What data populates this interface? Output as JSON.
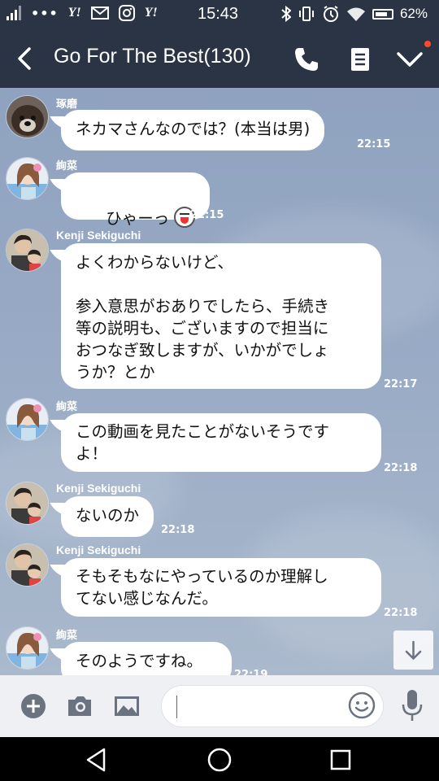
{
  "status_bar": {
    "time": "15:43",
    "carrier_icons": [
      "signal-icon",
      "more-dots-icon",
      "yahoo-icon",
      "mail-icon",
      "instagram-icon",
      "yahoo-icon"
    ],
    "more_dots": "•••",
    "yahoo_1": "Y!",
    "yahoo_2": "Y!",
    "system_icons": [
      "bluetooth-icon",
      "vibrate-icon",
      "alarm-icon",
      "wifi-icon",
      "battery-icon"
    ],
    "battery_percent": "62%",
    "battery_level": 0.62
  },
  "header": {
    "title": "Go For The Best(130)",
    "icons": [
      "back-icon",
      "phone-icon",
      "notes-icon",
      "chevron-check-icon"
    ],
    "notification_color": "#ff4a2b"
  },
  "messages": [
    {
      "sender": "琢磨",
      "text": "ネカマさんなのでは？(本当は男)",
      "time": "22:15",
      "avatar": "dog-avatar"
    },
    {
      "sender": "絢菜",
      "text": "ひゃーっ",
      "time": "22:15",
      "avatar": "girl-avatar",
      "sticker": "surprised-face-icon"
    },
    {
      "sender": "Kenji Sekiguchi",
      "text": "よくわからないけど、\n\n参入意思がおありでしたら、手続き\n等の説明も、ございますので担当に\nおつなぎ致しますが、いかがでしょ\nうか？とか",
      "time": "22:17",
      "avatar": "person-avatar"
    },
    {
      "sender": "絢菜",
      "text": "この動画を見たことがないそうです\nよ！",
      "time": "22:18",
      "avatar": "girl-avatar"
    },
    {
      "sender": "Kenji Sekiguchi",
      "text": "ないのか",
      "time": "22:18",
      "avatar": "person-avatar"
    },
    {
      "sender": "Kenji Sekiguchi",
      "text": "そもそもなにやっているのか理解し\nてない感じなんだ。",
      "time": "22:18",
      "avatar": "person-avatar"
    },
    {
      "sender": "絢菜",
      "text": "そのようですね。",
      "time": "22:19",
      "avatar": "girl-avatar"
    }
  ],
  "input_bar": {
    "icons": [
      "plus-icon",
      "camera-icon",
      "image-icon",
      "emoji-icon",
      "microphone-icon"
    ],
    "text_value": ""
  },
  "nav_bar": {
    "icons": [
      "nav-back-icon",
      "nav-home-icon",
      "nav-recent-icon"
    ]
  },
  "colors": {
    "header_bg": "#2b3445",
    "chat_bg": "#97a9c4",
    "bubble_bg": "#ffffff"
  }
}
